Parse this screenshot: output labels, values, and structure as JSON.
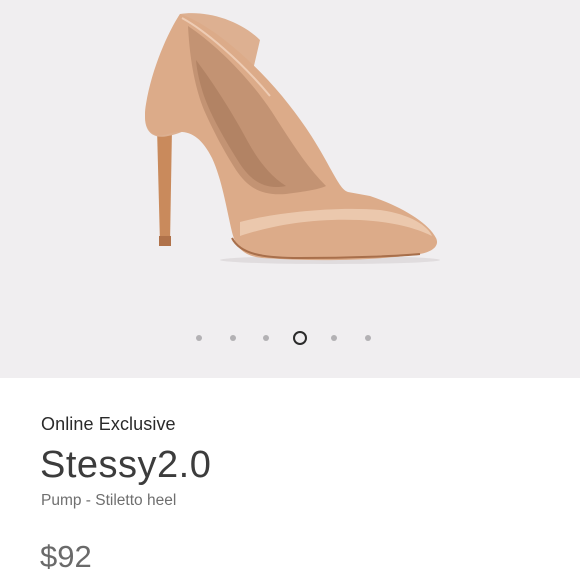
{
  "product": {
    "tagline": "Online Exclusive",
    "name": "Stessy2.0",
    "subtitle": "Pump - Stiletto heel",
    "price": "$92"
  },
  "gallery": {
    "image_count": 6,
    "active_index": 3
  },
  "colors": {
    "gallery_background": "#f0eef0",
    "shoe_color": "#d9a886",
    "active_dot": "#2b2b2b",
    "inactive_dot": "#b3b1b4"
  }
}
